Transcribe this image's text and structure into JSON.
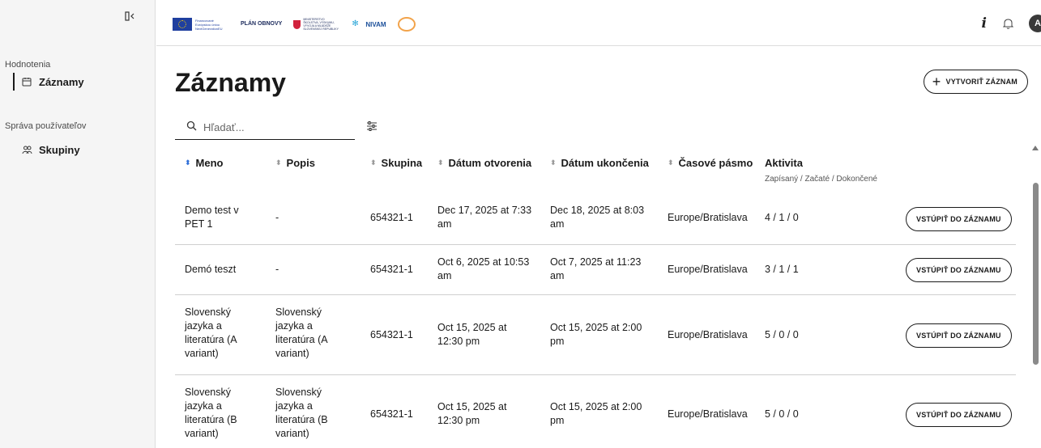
{
  "sidebar": {
    "groups": [
      {
        "title": "Hodnotenia",
        "items": [
          {
            "label": "Záznamy",
            "icon": "calendar-icon",
            "active": true
          }
        ]
      },
      {
        "title": "Správa používateľov",
        "items": [
          {
            "label": "Skupiny",
            "icon": "users-icon",
            "active": false
          }
        ]
      }
    ]
  },
  "header": {
    "logos": {
      "eu": "Financované Európskou úniou NextGenerationEU",
      "plan": "PLÁN OBNOVY",
      "ministry": "MINISTERSTVO ŠKOLSTVA, VÝSKUMU, VÝVOJA A MLÁDEŽE SLOVENSKEJ REPUBLIKY",
      "nivam": "NIVAM"
    },
    "avatar_initial": "A"
  },
  "page": {
    "title": "Záznamy",
    "create_button": "VYTVORIŤ ZÁZNAM",
    "search_placeholder": "Hľadať..."
  },
  "table": {
    "columns": [
      "Meno",
      "Popis",
      "Skupina",
      "Dátum otvorenia",
      "Dátum ukončenia",
      "Časové pásmo",
      "Aktivita"
    ],
    "activity_sub": "Zapísaný / Začaté / Dokončené",
    "sorted_column": "Meno",
    "action_label": "VSTÚPIŤ DO ZÁZNAMU",
    "rows": [
      {
        "name": "Demo test v PET 1",
        "desc": "-",
        "group": "654321-1",
        "open": "Dec 17, 2025 at 7:33 am",
        "close": "Dec 18, 2025 at 8:03 am",
        "tz": "Europe/Bratislava",
        "activity": "4 / 1 / 0"
      },
      {
        "name": "Demó teszt",
        "desc": "-",
        "group": "654321-1",
        "open": "Oct 6, 2025 at 10:53 am",
        "close": "Oct 7, 2025 at 11:23 am",
        "tz": "Europe/Bratislava",
        "activity": "3 / 1 / 1"
      },
      {
        "name": "Slovenský jazyka a literatúra (A variant)",
        "desc": "Slovenský jazyka a literatúra (A variant)",
        "group": "654321-1",
        "open": "Oct 15, 2025 at 12:30 pm",
        "close": "Oct 15, 2025 at 2:00 pm",
        "tz": "Europe/Bratislava",
        "activity": "5 / 0 / 0"
      },
      {
        "name": "Slovenský jazyka a literatúra (B variant)",
        "desc": "Slovenský jazyka a literatúra (B variant)",
        "group": "654321-1",
        "open": "Oct 15, 2025 at 12:30 pm",
        "close": "Oct 15, 2025 at 2:00 pm",
        "tz": "Europe/Bratislava",
        "activity": "5 / 0 / 0"
      }
    ]
  }
}
